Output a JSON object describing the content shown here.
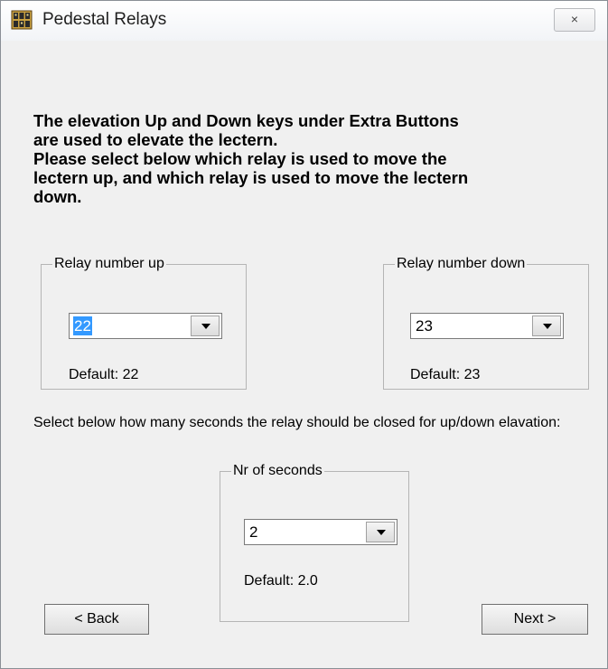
{
  "window": {
    "title": "Pedestal Relays",
    "close_icon": "×"
  },
  "intro": {
    "lines": [
      "The elevation Up and Down keys under Extra Buttons",
      "are used to elevate the lectern.",
      "Please select below which relay is used to move the",
      "lectern up, and which relay is used to move the lectern",
      "down."
    ]
  },
  "relay_up": {
    "legend": "Relay number up",
    "value": "22",
    "default": "Default: 22"
  },
  "relay_down": {
    "legend": "Relay number down",
    "value": "23",
    "default": "Default: 23"
  },
  "seconds_text": "Select below how many seconds the relay should be closed for up/down elavation:",
  "seconds": {
    "legend": "Nr of seconds",
    "value": "2",
    "default": "Default: 2.0"
  },
  "buttons": {
    "back": "< Back",
    "next": "Next >"
  },
  "colors": {
    "selection": "#3399ff",
    "dialog_bg": "#f0f0f0"
  }
}
